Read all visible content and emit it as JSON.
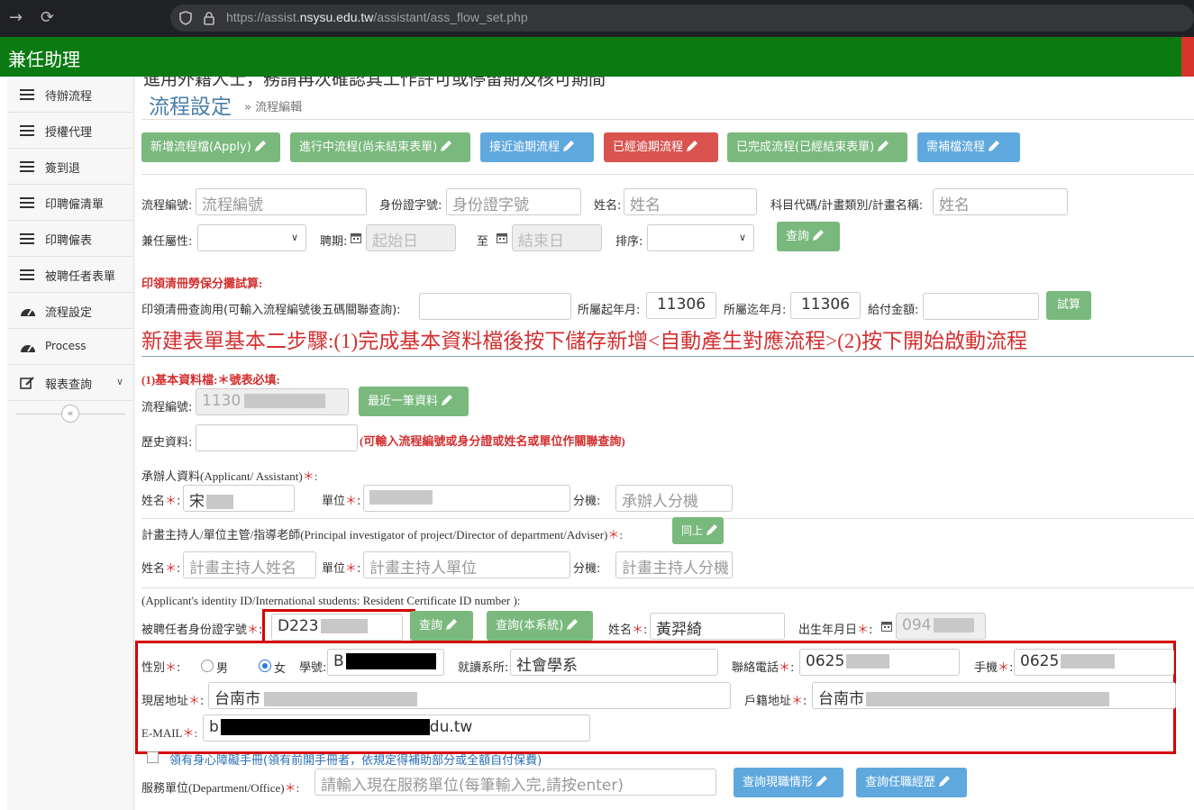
{
  "browser": {
    "url_prefix": "https://assist.",
    "url_domain": "nsysu.edu.tw",
    "url_path": "/assistant/ass_flow_set.php"
  },
  "app": {
    "brand": "兼任助理"
  },
  "sidebar": {
    "items": [
      {
        "label": "待辦流程",
        "icon": "list-icon"
      },
      {
        "label": "授權代理",
        "icon": "list-icon"
      },
      {
        "label": "簽到退",
        "icon": "list-icon"
      },
      {
        "label": "印聘僱清單",
        "icon": "list-icon"
      },
      {
        "label": "印聘僱表",
        "icon": "list-icon"
      },
      {
        "label": "被聘任者表單",
        "icon": "list-icon"
      },
      {
        "label": "流程設定",
        "icon": "dashboard-icon"
      },
      {
        "label": "Process",
        "icon": "dashboard-icon"
      },
      {
        "label": "報表查詢",
        "icon": "edit-icon"
      }
    ],
    "collapse": "«"
  },
  "page": {
    "cut_text": "進用外籍人士，務請再次確認其工作許可或停留期及核可期間",
    "title": "流程設定",
    "breadcrumb": "» 流程編輯"
  },
  "toolbar": [
    {
      "label": "新增流程檔(Apply)",
      "color": "green"
    },
    {
      "label": "進行中流程(尚未結束表單)",
      "color": "green"
    },
    {
      "label": "接近逾期流程",
      "color": "blue"
    },
    {
      "label": "已經逾期流程",
      "color": "red"
    },
    {
      "label": "已完成流程(已經結束表單)",
      "color": "green"
    },
    {
      "label": "需補檔流程",
      "color": "blue"
    }
  ],
  "search": {
    "flow_no_label": "流程編號:",
    "flow_no_ph": "流程編號",
    "id_label": "身份證字號:",
    "id_ph": "身份證字號",
    "name_label": "姓名:",
    "name_ph": "姓名",
    "subject_label": "科目代碼/計畫類別/計畫名稱:",
    "subject_ph": "姓名",
    "attr_label": "兼任屬性:",
    "period_label": "聘期:",
    "start_ph": "起始日",
    "to_label": "至",
    "end_ph": "結束日",
    "sort_label": "排序:",
    "query_btn": "查詢"
  },
  "labor": {
    "heading": "印領清冊勞保分攤試算:",
    "query_label": "印領清冊查詢用(可輸入流程編號後五碼關聯查詢):",
    "from_label": "所屬起年月:",
    "from_value": "11306",
    "to_label": "所屬迄年月:",
    "to_value": "11306",
    "amount_label": "給付金額:",
    "calc_btn": "試算"
  },
  "notice": "新建表單基本二步驟:(1)完成基本資料檔後按下儲存新增<自動產生對應流程>(2)按下開始啟動流程",
  "basic": {
    "heading": "(1)基本資料檔:",
    "required": "號表必填:",
    "flow_no_label": "流程編號:",
    "flow_no_value": "1130",
    "latest_btn": "最近一筆資料",
    "history_label": "歷史資料:",
    "history_hint": "(可輸入流程編號或身分證或姓名或單位作關聯查詢)"
  },
  "applicant": {
    "heading": "承辦人資料(Applicant/ Assistant)",
    "name_label": "姓名",
    "name_value": "宋",
    "unit_label": "單位",
    "ext_label": "分機",
    "ext_ph": "承辦人分機"
  },
  "pi": {
    "heading": "計畫主持人/單位主管/指導老師(Principal investigator of project/Director of department/Adviser)",
    "same_btn": "同上",
    "name_label": "姓名",
    "name_ph": "計畫主持人姓名",
    "unit_label": "單位",
    "unit_ph": "計畫主持人單位",
    "ext_label": "分機",
    "ext_ph": "計畫主持人分機"
  },
  "employee": {
    "note": "(Applicant's identity ID/International students: Resident Certificate ID number ):",
    "id_label": "被聘任者身份證字號",
    "id_value": "D223",
    "query_btn": "查詢",
    "query_local_btn": "查詢(本系統)",
    "name_label": "姓名",
    "name_value": "黃羿綺",
    "birth_label": "出生年月日",
    "birth_value": "094",
    "gender_label": "性別",
    "male": "男",
    "female": "女",
    "student_no_label": "學號:",
    "student_no_value": "B",
    "dept_label": "就讀系所:",
    "dept_value": "社會學系",
    "phone_label": "聯絡電話",
    "phone_value": "0625",
    "mobile_label": "手機",
    "mobile_value": "0625",
    "address_label": "現居地址",
    "address_value": "台南市",
    "reg_address_label": "戶籍地址",
    "reg_address_value": "台南市",
    "email_label": "E-MAIL",
    "email_start": "b",
    "email_end": "du.tw",
    "disability_note": "領有身心障礙手冊(領有前開手冊者，依規定得補助部分或全額自付保費)",
    "service_label": "服務單位(Department/Office)",
    "service_ph": "請輸入現在服務單位(每筆輸入完,請按enter)",
    "query_job_btn": "查詢現職情形",
    "query_history_btn": "查詢任職經歷"
  },
  "colors": {
    "header_green": "#0b7a13",
    "btn_green": "#79b97d",
    "btn_blue": "#5fa8de",
    "btn_red": "#d9534f",
    "highlight": "#d40000"
  }
}
